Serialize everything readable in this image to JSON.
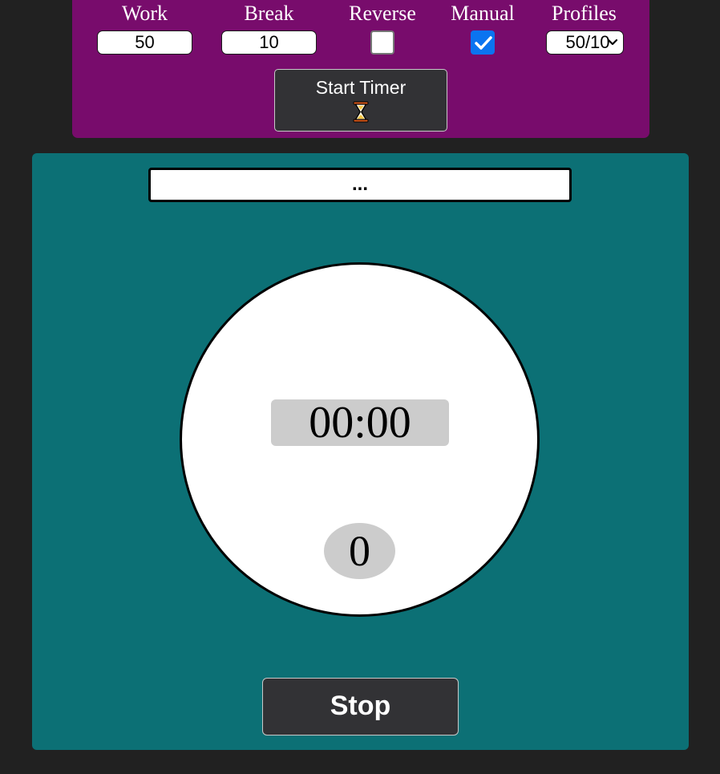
{
  "settings": {
    "work": {
      "label": "Work",
      "value": "50"
    },
    "break": {
      "label": "Break",
      "value": "10"
    },
    "reverse": {
      "label": "Reverse",
      "checked": false
    },
    "manual": {
      "label": "Manual",
      "checked": true
    },
    "profiles": {
      "label": "Profiles",
      "selected": "50/10"
    },
    "start_button": {
      "label": "Start Timer",
      "icon": "hourglass-icon"
    }
  },
  "timer": {
    "task_text": "...",
    "time": "00:00",
    "count": "0",
    "stop_label": "Stop"
  },
  "colors": {
    "background": "#212121",
    "settings_panel": "#780c6c",
    "timer_panel": "#0c7075",
    "button": "#323235",
    "checkbox_checked": "#0b74f0",
    "display_bg": "#cccccc"
  }
}
